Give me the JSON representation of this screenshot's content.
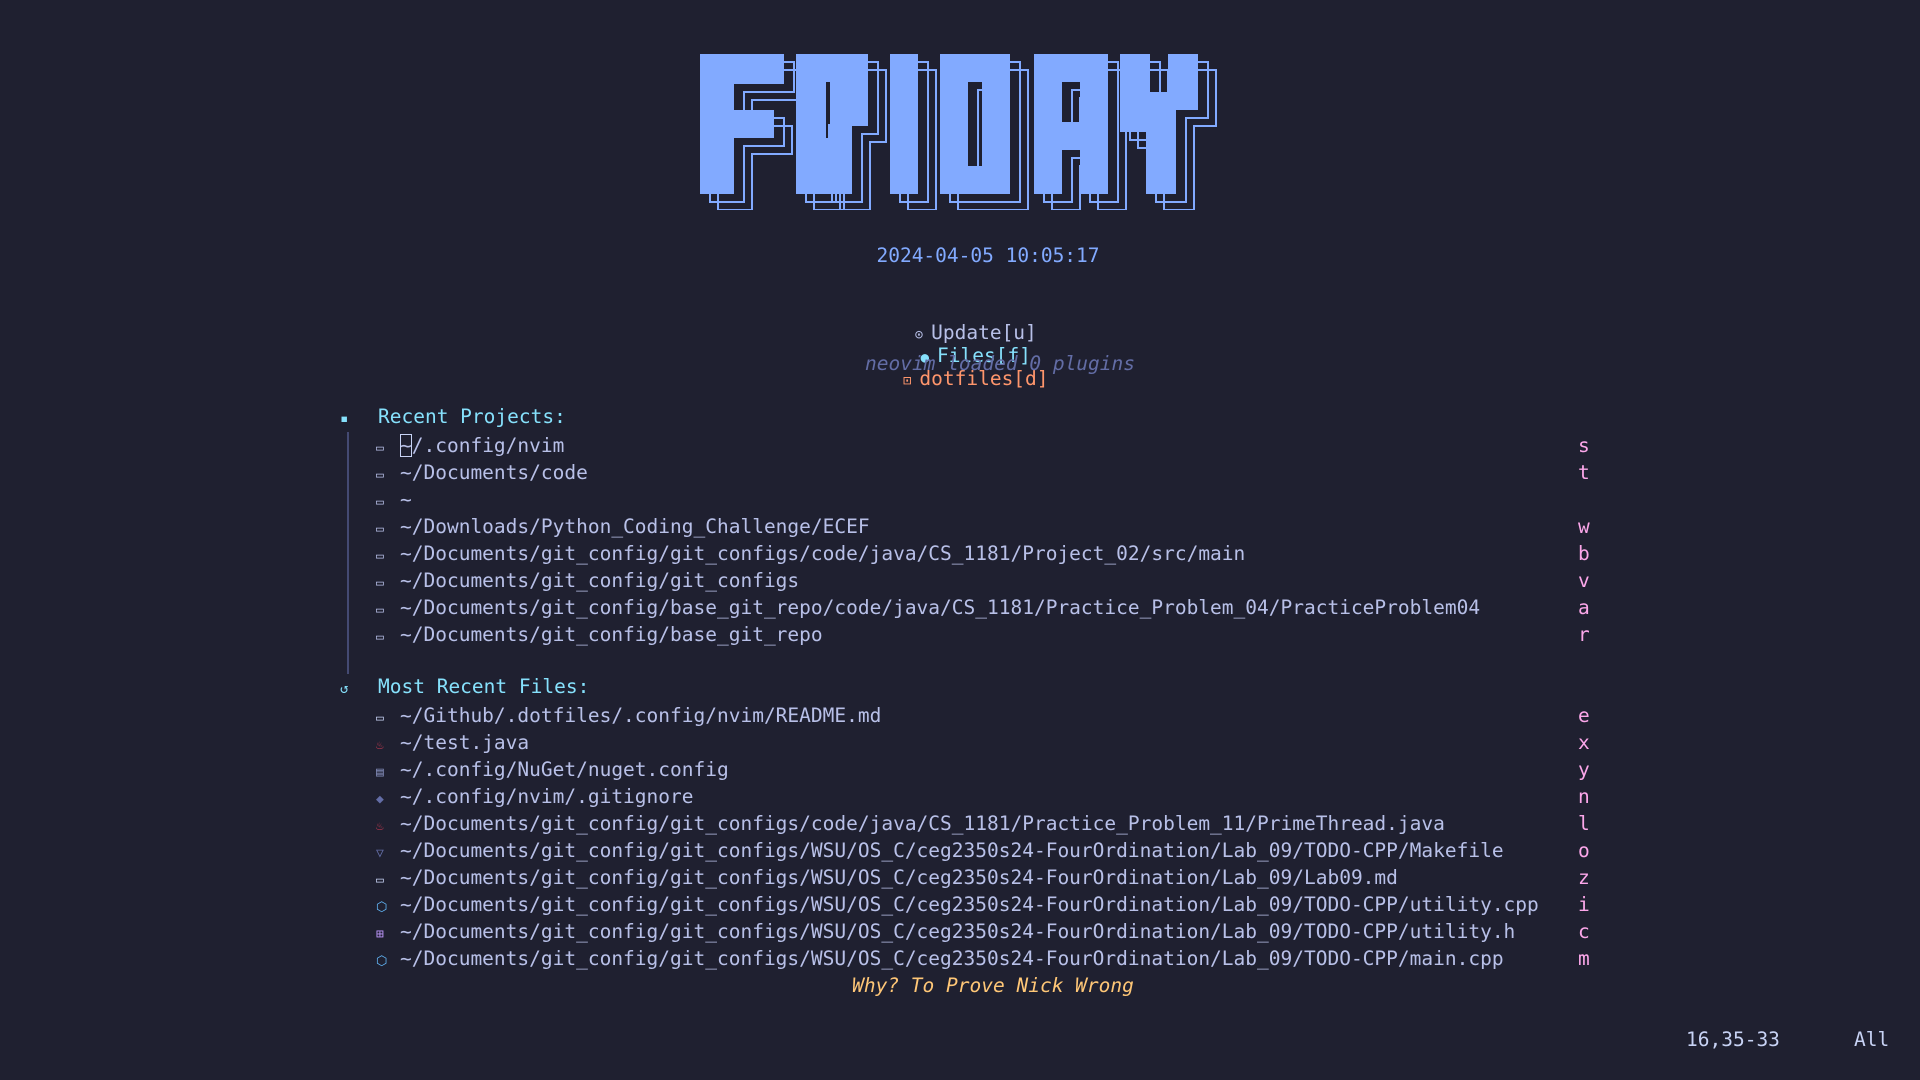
{
  "logo": {
    "text": "FRIDAY",
    "color": "#82aaff"
  },
  "clock": "2024-04-05 10:05:17",
  "buttons": [
    {
      "icon": "update-icon",
      "glyph": "⊙",
      "label": "Update[u]"
    },
    {
      "icon": "files-icon",
      "glyph": "●",
      "label": "Files[f]"
    },
    {
      "icon": "package-icon",
      "glyph": "⊡",
      "label": "dotfiles[d]"
    }
  ],
  "loaded_msg": "neovim loaded 0 plugins",
  "projects": {
    "title": "Recent Projects:",
    "items": [
      {
        "path": "~/.config/nvim",
        "key": "s"
      },
      {
        "path": "~/Documents/code",
        "key": "t"
      },
      {
        "path": "~",
        "key": ""
      },
      {
        "path": "~/Downloads/Python_Coding_Challenge/ECEF",
        "key": "w"
      },
      {
        "path": "~/Documents/git_config/git_configs/code/java/CS_1181/Project_02/src/main",
        "key": "b"
      },
      {
        "path": "~/Documents/git_config/git_configs",
        "key": "v"
      },
      {
        "path": "~/Documents/git_config/base_git_repo/code/java/CS_1181/Practice_Problem_04/PracticeProblem04",
        "key": "a"
      },
      {
        "path": "~/Documents/git_config/base_git_repo",
        "key": "r"
      }
    ]
  },
  "files": {
    "title": "Most Recent Files:",
    "items": [
      {
        "icon": "markdown-icon",
        "glyph": "▭",
        "color": "#c8d3f5",
        "path": "~/Github/.dotfiles/.config/nvim/README.md",
        "key": "e"
      },
      {
        "icon": "java-icon",
        "glyph": "♨",
        "color": "#c53b53",
        "path": "~/test.java",
        "key": "x"
      },
      {
        "icon": "config-file-icon",
        "glyph": "▤",
        "color": "#828bb8",
        "path": "~/.config/NuGet/nuget.config",
        "key": "y"
      },
      {
        "icon": "git-icon",
        "glyph": "◆",
        "color": "#636da6",
        "path": "~/.config/nvim/.gitignore",
        "key": "n"
      },
      {
        "icon": "java-icon",
        "glyph": "♨",
        "color": "#c53b53",
        "path": "~/Documents/git_config/git_configs/code/java/CS_1181/Practice_Problem_11/PrimeThread.java",
        "key": "l"
      },
      {
        "icon": "makefile-icon",
        "glyph": "▽",
        "color": "#636da6",
        "path": "~/Documents/git_config/git_configs/WSU/OS_C/ceg2350s24-FourOrdination/Lab_09/TODO-CPP/Makefile",
        "key": "o"
      },
      {
        "icon": "markdown-icon",
        "glyph": "▭",
        "color": "#c8d3f5",
        "path": "~/Documents/git_config/git_configs/WSU/OS_C/ceg2350s24-FourOrdination/Lab_09/Lab09.md",
        "key": "z"
      },
      {
        "icon": "cpp-icon",
        "glyph": "⬡",
        "color": "#65bcff",
        "path": "~/Documents/git_config/git_configs/WSU/OS_C/ceg2350s24-FourOrdination/Lab_09/TODO-CPP/utility.cpp",
        "key": "i"
      },
      {
        "icon": "header-icon",
        "glyph": "⊞",
        "color": "#c099ff",
        "path": "~/Documents/git_config/git_configs/WSU/OS_C/ceg2350s24-FourOrdination/Lab_09/TODO-CPP/utility.h",
        "key": "c"
      },
      {
        "icon": "cpp-icon",
        "glyph": "⬡",
        "color": "#65bcff",
        "path": "~/Documents/git_config/git_configs/WSU/OS_C/ceg2350s24-FourOrdination/Lab_09/TODO-CPP/main.cpp",
        "key": "m"
      }
    ]
  },
  "footer": "Why? To Prove Nick Wrong",
  "status": {
    "position": "16,35-33",
    "scroll": "All"
  }
}
